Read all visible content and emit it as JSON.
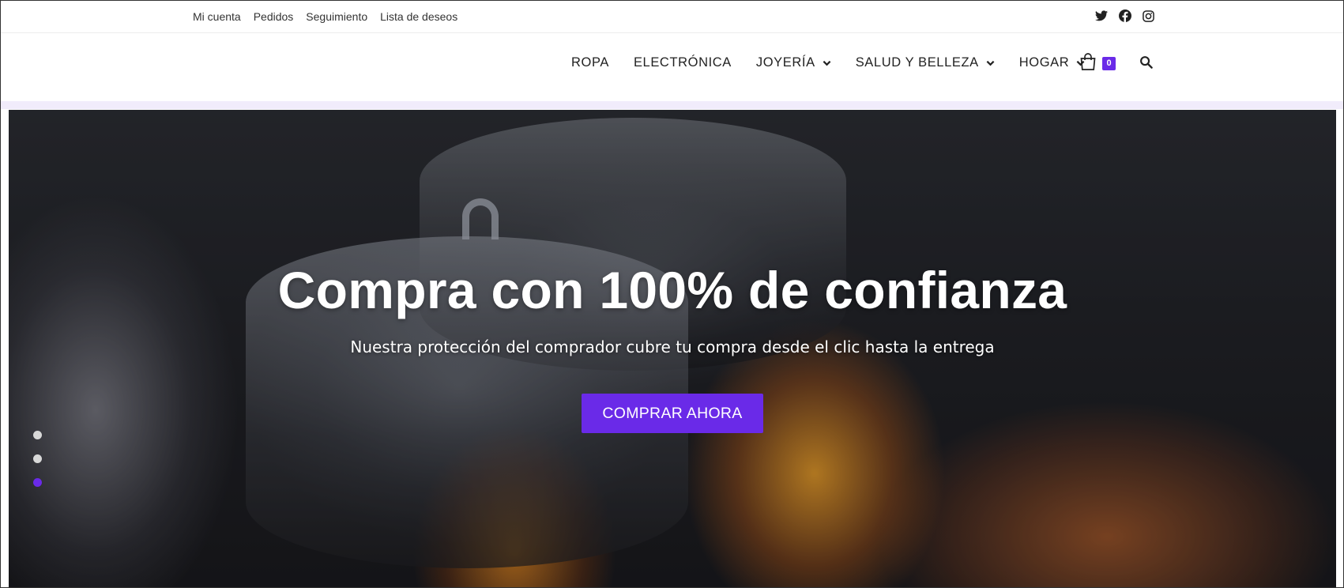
{
  "topbar": {
    "links": [
      "Mi cuenta",
      "Pedidos",
      "Seguimiento",
      "Lista de deseos"
    ],
    "social_icons": [
      "twitter-icon",
      "facebook-icon",
      "instagram-icon"
    ]
  },
  "nav": {
    "items": [
      {
        "label": "ROPA",
        "has_dropdown": false
      },
      {
        "label": "ELECTRÓNICA",
        "has_dropdown": false
      },
      {
        "label": "JOYERÍA",
        "has_dropdown": true
      },
      {
        "label": "SALUD Y BELLEZA",
        "has_dropdown": true
      },
      {
        "label": "HOGAR",
        "has_dropdown": true
      }
    ],
    "cart_count": "0",
    "cart_icon": "shopping-bag-icon",
    "search_icon": "search-icon"
  },
  "hero": {
    "title": "Compra con 100% de confianza",
    "subtitle": "Nuestra protección del comprador cubre tu compra desde el clic hasta la entrega",
    "button_label": "COMPRAR AHORA",
    "slides": 3,
    "active_slide": 3
  },
  "colors": {
    "accent": "#6a2ae8",
    "header_strip": "#f1ecfb",
    "dot_inactive": "#d8d8d8"
  }
}
